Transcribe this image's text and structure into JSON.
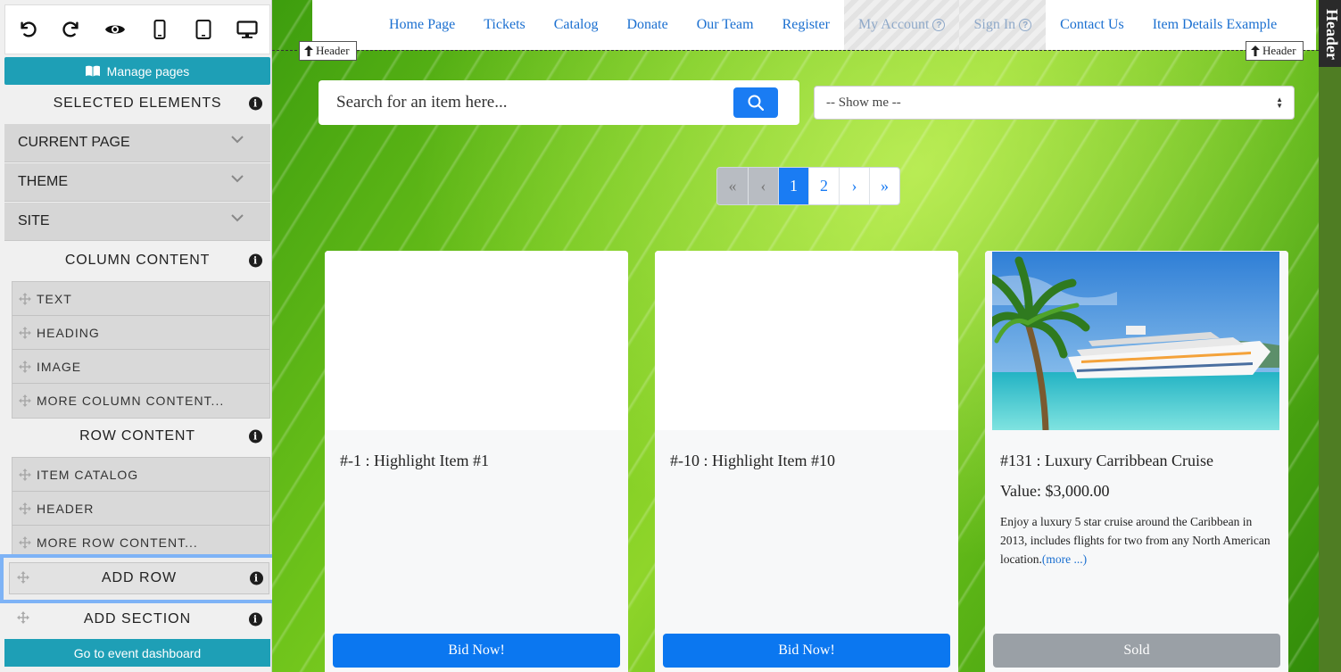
{
  "sidebar": {
    "manage_pages": "Manage pages",
    "selected_elements": "SELECTED ELEMENTS",
    "accordions": [
      "CURRENT PAGE",
      "THEME",
      "SITE"
    ],
    "column_content": {
      "title": "COLUMN CONTENT",
      "items": [
        "TEXT",
        "HEADING",
        "IMAGE",
        "MORE COLUMN CONTENT..."
      ]
    },
    "row_content": {
      "title": "ROW CONTENT",
      "items": [
        "ITEM CATALOG",
        "HEADER",
        "MORE ROW CONTENT..."
      ]
    },
    "add_row": "ADD ROW",
    "add_section": "ADD SECTION",
    "dashboard": "Go to event dashboard"
  },
  "nav": {
    "items": [
      "Home Page",
      "Tickets",
      "Catalog",
      "Donate",
      "Our Team",
      "Register",
      "My Account",
      "Sign In",
      "Contact Us",
      "Item Details Example"
    ]
  },
  "header_tag": "Header",
  "right_strip_label": "Header",
  "search": {
    "placeholder": "Search for an item here..."
  },
  "filter": {
    "selected": "-- Show me --"
  },
  "pagination": {
    "items": [
      "«",
      "‹",
      "1",
      "2",
      "›",
      "»"
    ],
    "current": "1"
  },
  "cards": [
    {
      "title": "#-1 : Highlight Item #1",
      "button": "Bid Now!"
    },
    {
      "title": "#-10 : Highlight Item #10",
      "button": "Bid Now!"
    },
    {
      "title": "#131 : Luxury Carribbean Cruise",
      "value": "Value: $3,000.00",
      "description": "Enjoy a luxury 5 star cruise around the Caribbean in 2013, includes flights for two from any North American location.",
      "more": "(more ...)",
      "button": "Sold"
    }
  ],
  "colors": {
    "accent_teal": "#1e9fb6",
    "primary_blue": "#1a7cf3",
    "highlight_border": "#7eb3f6",
    "sold_gray": "#9aa0a6"
  }
}
